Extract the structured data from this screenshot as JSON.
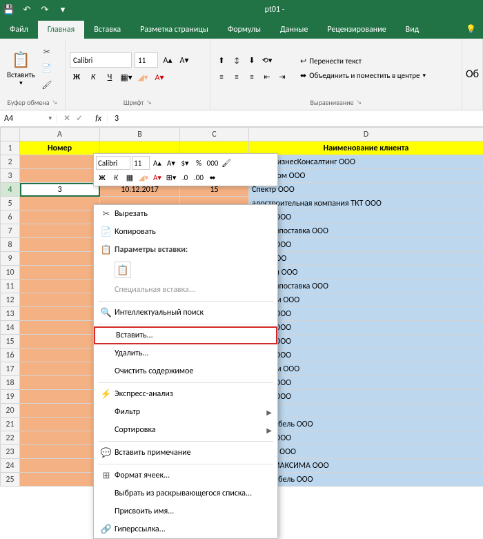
{
  "titlebar": {
    "title": "pt01 -",
    "save_icon": "💾",
    "undo_icon": "↶",
    "redo_icon": "↷"
  },
  "tabs": {
    "file": "Файл",
    "home": "Главная",
    "insert": "Вставка",
    "pagelayout": "Разметка страницы",
    "formulas": "Формулы",
    "data": "Данные",
    "review": "Рецензирование",
    "view": "Вид"
  },
  "ribbon": {
    "clipboard": {
      "label": "Буфер обмена",
      "paste": "Вставить"
    },
    "font": {
      "label": "Шрифт",
      "name": "Calibri",
      "size": "11",
      "bold": "Ж",
      "italic": "К",
      "underline": "Ч"
    },
    "alignment": {
      "label": "Выравнивание",
      "wrap": "Перенести текст",
      "merge": "Объединить и поместить в центре"
    }
  },
  "formula_bar": {
    "name_box": "A4",
    "fx": "fx",
    "content": "3"
  },
  "columns": [
    "A",
    "B",
    "C",
    "D"
  ],
  "headers": {
    "A": "Номер",
    "D": "Наименование клиента"
  },
  "row4": {
    "A": "3",
    "B": "10.12.2017",
    "C": "15"
  },
  "clients": {
    "2": "СтройБизнесКонсалтинг ООО",
    "3": "СтройКом ООО",
    "4": "Спектр ООО",
    "5": "адостроительная компания ТКТ ООО",
    "6": "енада ООО",
    "7": "ецпромпоставка ООО",
    "8": "енада ООО",
    "9": "елла ООО",
    "10": "ройКом ООО",
    "11": "ецпромпоставка ООО",
    "12": "ортТайм ООО",
    "13": "енада ООО",
    "14": "енада ООО",
    "15": "енада ООО",
    "16": "енада ООО",
    "17": "ортТайм ООО",
    "18": "енада ООО",
    "19": "енада ООО",
    "20": "",
    "21": "екломебель ООО",
    "22": "енада ООО",
    "23": "аломит ООО",
    "24": "УДИЯ МАКСИМА ООО",
    "25": "екломебель ООО"
  },
  "mini_toolbar": {
    "font": "Calibri",
    "size": "11",
    "bold": "Ж",
    "italic": "К"
  },
  "context_menu": {
    "cut": "Вырезать",
    "copy": "Копировать",
    "paste_options": "Параметры вставки:",
    "paste_special": "Специальная вставка...",
    "smart_lookup": "Интеллектуальный поиск",
    "insert": "Вставить...",
    "delete": "Удалить...",
    "clear": "Очистить содержимое",
    "quick_analysis": "Экспресс-анализ",
    "filter": "Фильтр",
    "sort": "Сортировка",
    "insert_comment": "Вставить примечание",
    "format_cells": "Формат ячеек...",
    "pick_from_list": "Выбрать из раскрывающегося списка...",
    "define_name": "Присвоить имя...",
    "hyperlink": "Гиперссылка..."
  }
}
